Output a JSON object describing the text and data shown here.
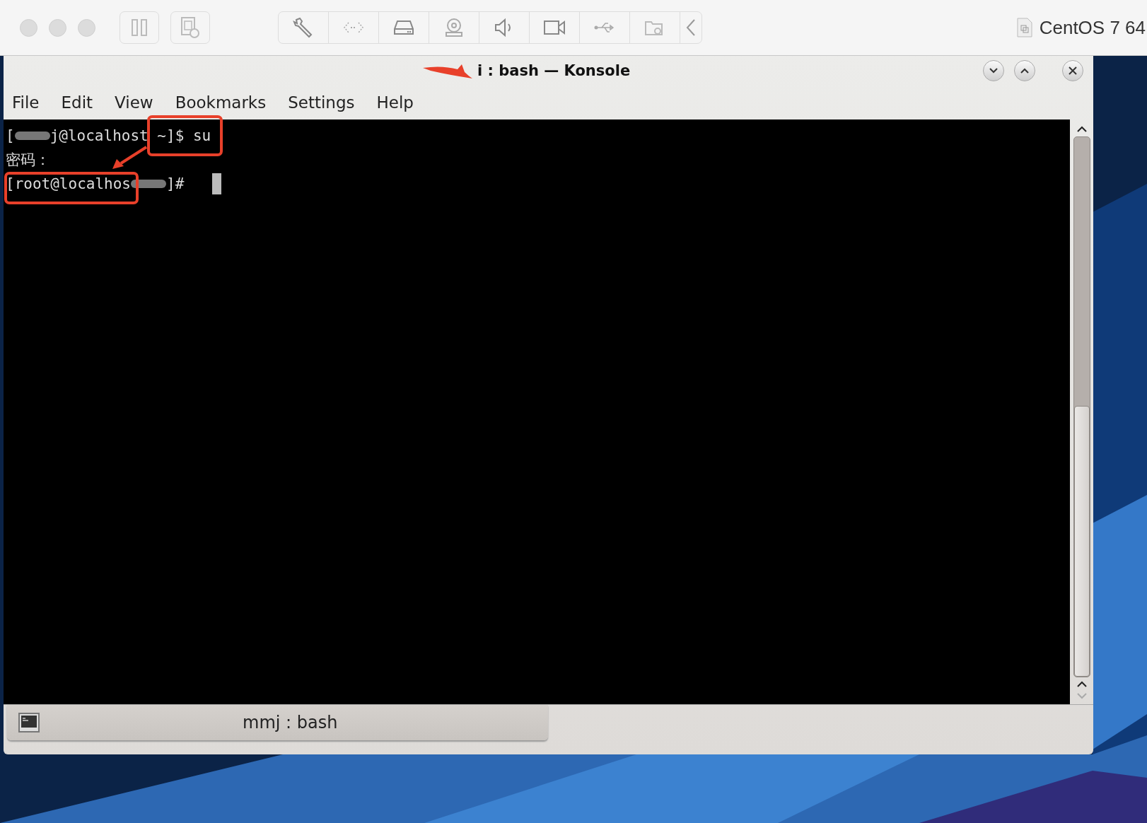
{
  "toolbar": {
    "vm_name": "CentOS 7 64"
  },
  "window": {
    "title": "i : bash — Konsole"
  },
  "menu": [
    "File",
    "Edit",
    "View",
    "Bookmarks",
    "Settings",
    "Help"
  ],
  "terminal": {
    "lines": [
      {
        "segments": [
          {
            "kind": "text",
            "text": "["
          },
          {
            "kind": "redacted"
          },
          {
            "kind": "text",
            "text": "j@localhost ~]$ su"
          }
        ]
      },
      {
        "segments": [
          {
            "kind": "text",
            "text": "密码："
          }
        ]
      },
      {
        "segments": [
          {
            "kind": "text",
            "text": "[root@localhos"
          },
          {
            "kind": "redacted"
          },
          {
            "kind": "text",
            "text": "]#  "
          },
          {
            "kind": "cursor"
          }
        ]
      }
    ]
  },
  "tab": {
    "label": "mmj : bash"
  }
}
